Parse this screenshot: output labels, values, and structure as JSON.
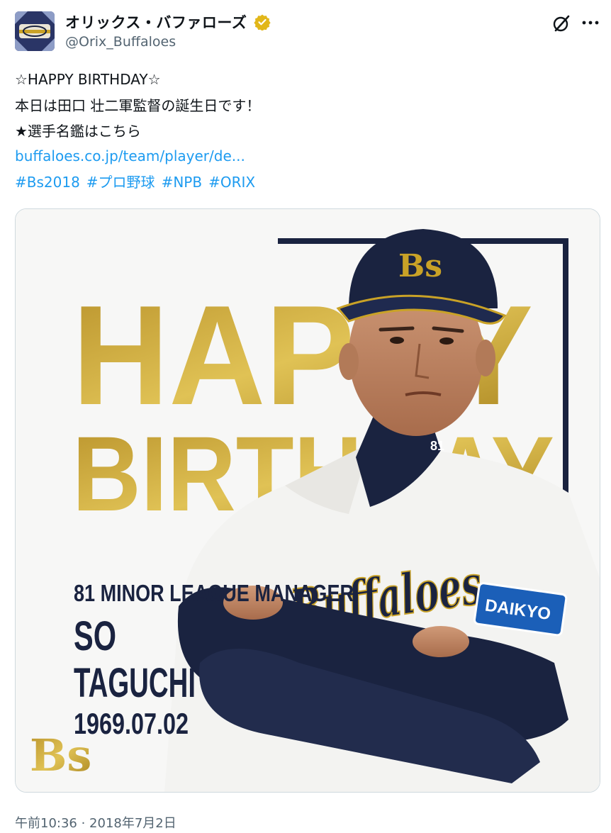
{
  "author": {
    "name": "オリックス・バファローズ",
    "handle": "@Orix_Buffaloes",
    "avatar_icon": "buffaloes-logo-avatar",
    "verified_icon": "verified-badge-icon",
    "colors": {
      "verified": "#e2b719"
    }
  },
  "header_actions": {
    "grok_icon": "grok-icon",
    "more_icon": "more-icon"
  },
  "tweet": {
    "lines": [
      "☆HAPPY BIRTHDAY☆",
      "本日は田口 壮二軍監督の誕生日です！",
      "★選手名鑑はこちら"
    ],
    "link": "buffaloes.co.jp/team/player/de...",
    "hashtags": [
      "#Bs2018",
      "#プロ野球",
      "#NPB",
      "#ORIX"
    ]
  },
  "media": {
    "headline_1": "HAPPY",
    "headline_2": "BIRTHDAY",
    "role": "81 MINOR LEAGUE MANAGER",
    "name_first": "SO",
    "name_last": "TAGUCHI",
    "birthdate": "1969.07.02",
    "logo_text": "Bs",
    "cap_logo": "Bs",
    "collar_number": "81",
    "jersey_text": "Buffaloes",
    "sleeve_badge": "DAIKYO",
    "colors": {
      "gold": "#c9a227",
      "navy": "#1a2340",
      "badge_blue": "#1b5fb8"
    }
  },
  "timestamp": "午前10:36 · 2018年7月2日"
}
